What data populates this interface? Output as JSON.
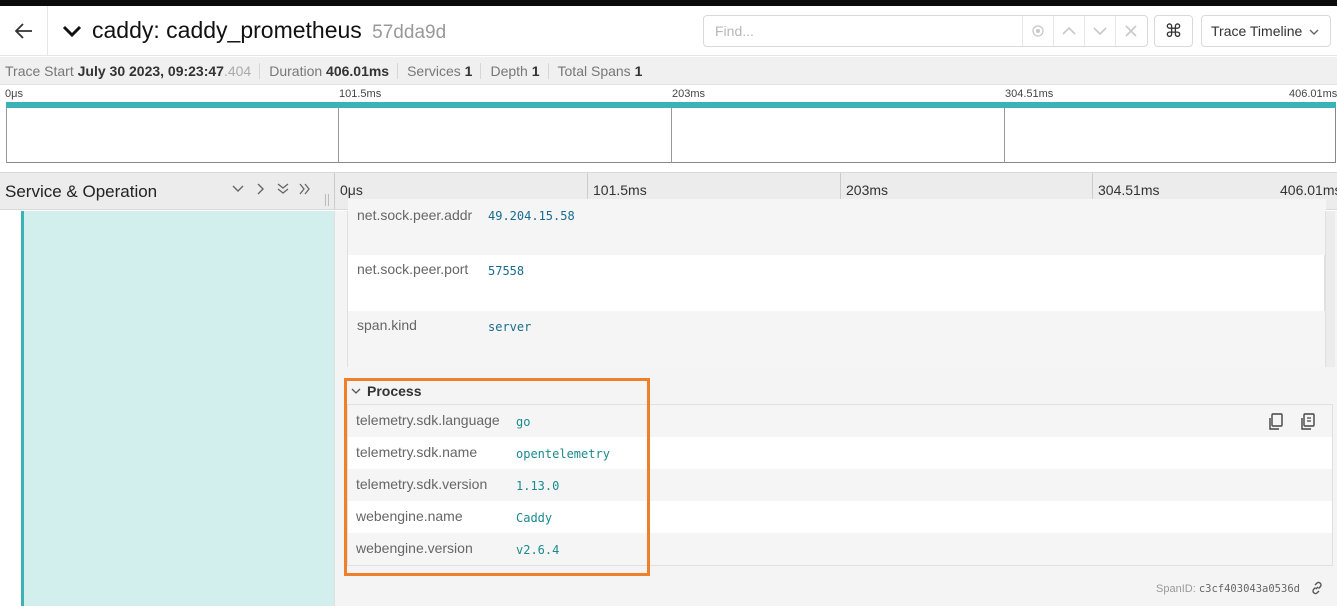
{
  "header": {
    "service": "caddy:",
    "operation": "caddy_prometheus",
    "trace_id": "57dda9d",
    "find_placeholder": "Find...",
    "view_mode": "Trace Timeline"
  },
  "meta": {
    "trace_start_label": "Trace Start",
    "trace_start_date": "July 30 2023, 09:23:47",
    "trace_start_ms": ".404",
    "duration_label": "Duration",
    "duration_value": "406.01ms",
    "services_label": "Services",
    "services_value": "1",
    "depth_label": "Depth",
    "depth_value": "1",
    "total_spans_label": "Total Spans",
    "total_spans_value": "1"
  },
  "minimap": {
    "ticks": [
      "0μs",
      "101.5ms",
      "203ms",
      "304.51ms",
      "406.01ms"
    ]
  },
  "timeline_header": {
    "title": "Service & Operation",
    "ticks": [
      "0μs",
      "101.5ms",
      "203ms",
      "304.51ms",
      "406.01ms"
    ]
  },
  "tags": [
    {
      "key": "net.sock.peer.addr",
      "value": "49.204.15.58"
    },
    {
      "key": "net.sock.peer.port",
      "value": "57558"
    },
    {
      "key": "span.kind",
      "value": "server"
    }
  ],
  "process": {
    "title": "Process",
    "rows": [
      {
        "key": "telemetry.sdk.language",
        "value": "go"
      },
      {
        "key": "telemetry.sdk.name",
        "value": "opentelemetry"
      },
      {
        "key": "telemetry.sdk.version",
        "value": "1.13.0"
      },
      {
        "key": "webengine.name",
        "value": "Caddy"
      },
      {
        "key": "webengine.version",
        "value": "v2.6.4"
      }
    ]
  },
  "span": {
    "id_label": "SpanID:",
    "id_value": "c3cf403043a0536d"
  },
  "colors": {
    "accent_teal": "#3bb3b6",
    "span_fill": "#d2efee",
    "highlight_orange": "#f07f2a"
  },
  "icons": [
    "back-arrow-icon",
    "chevron-down-icon",
    "locate-icon",
    "chevron-up-icon",
    "close-icon",
    "command-icon",
    "copy-icon",
    "copy-json-icon",
    "link-icon"
  ]
}
